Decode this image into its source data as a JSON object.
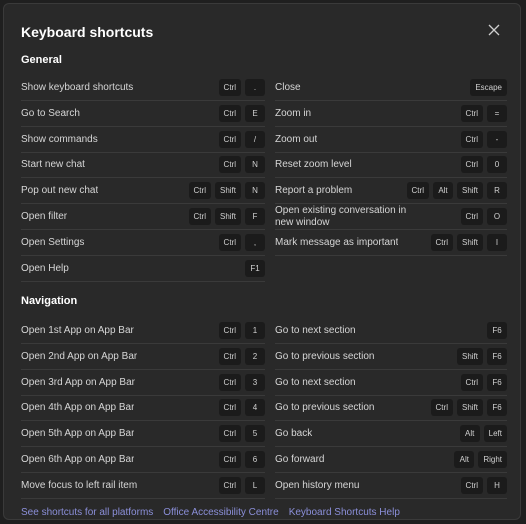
{
  "dialog": {
    "title": "Keyboard shortcuts",
    "close_icon": "close-icon"
  },
  "general": {
    "heading": "General",
    "left": [
      {
        "label": "Show keyboard shortcuts",
        "keys": [
          "Ctrl",
          "."
        ]
      },
      {
        "label": "Go to Search",
        "keys": [
          "Ctrl",
          "E"
        ]
      },
      {
        "label": "Show commands",
        "keys": [
          "Ctrl",
          "/"
        ]
      },
      {
        "label": "Start new chat",
        "keys": [
          "Ctrl",
          "N"
        ]
      },
      {
        "label": "Pop out new chat",
        "keys": [
          "Ctrl",
          "Shift",
          "N"
        ]
      },
      {
        "label": "Open filter",
        "keys": [
          "Ctrl",
          "Shift",
          "F"
        ]
      },
      {
        "label": "Open Settings",
        "keys": [
          "Ctrl",
          ","
        ]
      },
      {
        "label": "Open Help",
        "keys": [
          "F1"
        ]
      }
    ],
    "right": [
      {
        "label": "Close",
        "keys": [
          "Escape"
        ]
      },
      {
        "label": "Zoom in",
        "keys": [
          "Ctrl",
          "="
        ]
      },
      {
        "label": "Zoom out",
        "keys": [
          "Ctrl",
          "-"
        ]
      },
      {
        "label": "Reset zoom level",
        "keys": [
          "Ctrl",
          "0"
        ]
      },
      {
        "label": "Report a problem",
        "keys": [
          "Ctrl",
          "Alt",
          "Shift",
          "R"
        ]
      },
      {
        "label": "Open existing conversation in new window",
        "keys": [
          "Ctrl",
          "O"
        ]
      },
      {
        "label": "Mark message as important",
        "keys": [
          "Ctrl",
          "Shift",
          "I"
        ]
      }
    ]
  },
  "navigation": {
    "heading": "Navigation",
    "left": [
      {
        "label": "Open 1st App on App Bar",
        "keys": [
          "Ctrl",
          "1"
        ]
      },
      {
        "label": "Open 2nd App on App Bar",
        "keys": [
          "Ctrl",
          "2"
        ]
      },
      {
        "label": "Open 3rd App on App Bar",
        "keys": [
          "Ctrl",
          "3"
        ]
      },
      {
        "label": "Open 4th App on App Bar",
        "keys": [
          "Ctrl",
          "4"
        ]
      },
      {
        "label": "Open 5th App on App Bar",
        "keys": [
          "Ctrl",
          "5"
        ]
      },
      {
        "label": "Open 6th App on App Bar",
        "keys": [
          "Ctrl",
          "6"
        ]
      },
      {
        "label": "Move focus to left rail item",
        "keys": [
          "Ctrl",
          "L"
        ]
      }
    ],
    "right": [
      {
        "label": "Go to next section",
        "keys": [
          "F6"
        ]
      },
      {
        "label": "Go to previous section",
        "keys": [
          "Shift",
          "F6"
        ]
      },
      {
        "label": "Go to next section",
        "keys": [
          "Ctrl",
          "F6"
        ]
      },
      {
        "label": "Go to previous section",
        "keys": [
          "Ctrl",
          "Shift",
          "F6"
        ]
      },
      {
        "label": "Go back",
        "keys": [
          "Alt",
          "Left"
        ]
      },
      {
        "label": "Go forward",
        "keys": [
          "Alt",
          "Right"
        ]
      },
      {
        "label": "Open history menu",
        "keys": [
          "Ctrl",
          "H"
        ]
      }
    ]
  },
  "footer": {
    "links": [
      "See shortcuts for all platforms",
      "Office Accessibility Centre",
      "Keyboard Shortcuts Help"
    ]
  }
}
